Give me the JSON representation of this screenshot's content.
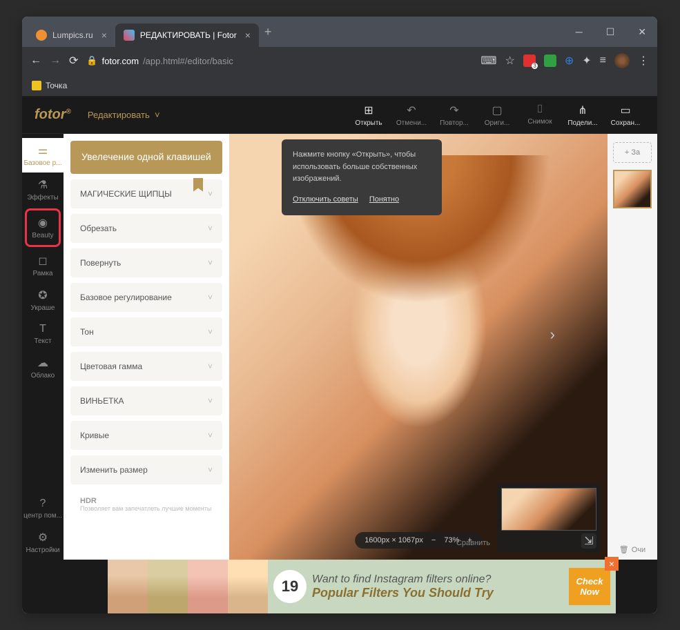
{
  "browser": {
    "tabs": [
      {
        "title": "Lumpics.ru",
        "active": false,
        "favicon": "#f09030"
      },
      {
        "title": "РЕДАКТИРОВАТЬ | Fotor",
        "active": true,
        "favicon": "#f04060"
      }
    ],
    "url_domain": "fotor.com",
    "url_path": "/app.html#/editor/basic",
    "bookmark": "Точка"
  },
  "app": {
    "logo": "fotor",
    "mode": "Редактировать",
    "top_tools": [
      {
        "label": "Открыть"
      },
      {
        "label": "Отмени..."
      },
      {
        "label": "Повтор..."
      },
      {
        "label": "Ориги..."
      },
      {
        "label": "Снимок"
      },
      {
        "label": "Подели..."
      },
      {
        "label": "Сохран..."
      }
    ],
    "rail": [
      {
        "label": "Базовое р...",
        "sel": true
      },
      {
        "label": "Эффекты"
      },
      {
        "label": "Beauty",
        "hl": true
      },
      {
        "label": "Рамка"
      },
      {
        "label": "Украше"
      },
      {
        "label": "Текст"
      },
      {
        "label": "Облако"
      }
    ],
    "rail_bottom": [
      {
        "label": "центр пом..."
      },
      {
        "label": "Настройки"
      }
    ],
    "one_tap": "Увелечение одной клавишей",
    "accordion": [
      {
        "label": "МАГИЧЕСКИЕ ЩИПЦЫ",
        "ribbon": true
      },
      {
        "label": "Обрезать"
      },
      {
        "label": "Повернуть"
      },
      {
        "label": "Базовое регулирование"
      },
      {
        "label": "Тон"
      },
      {
        "label": "Цветовая гамма"
      },
      {
        "label": "ВИНЬЕТКА"
      },
      {
        "label": "Кривые"
      },
      {
        "label": "Изменить размер"
      }
    ],
    "hdr": {
      "title": "HDR",
      "sub": "Позволяет вам запечатлеть лучшие моменты"
    },
    "tip": {
      "text": "Нажмите кнопку «Открыть», чтобы использовать больше собственных изображений.",
      "link1": "Отключить советы",
      "link2": "Понятно"
    },
    "zoom": {
      "dims": "1600px × 1067px",
      "pct": "73%",
      "compare": "Сравнить"
    },
    "right": {
      "add": "За",
      "clear": "Очи"
    },
    "ad": {
      "num": "19",
      "l1": "Want to find Instagram filters online?",
      "l2": "Popular Filters You Should Try",
      "cta1": "Check",
      "cta2": "Now"
    }
  }
}
